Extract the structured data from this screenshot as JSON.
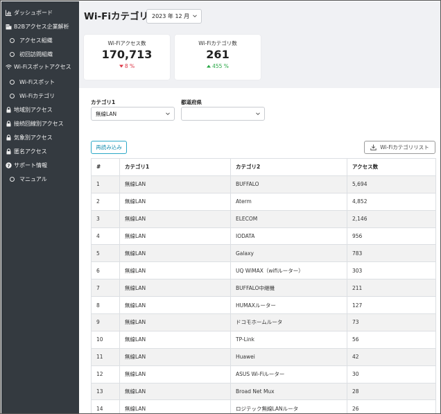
{
  "sidebar": {
    "items": [
      {
        "label": "ダッシュボード",
        "icon": "chart-bar-icon",
        "sub": false
      },
      {
        "label": "B2Bアクセス企業解析",
        "icon": "building-icon",
        "sub": false
      },
      {
        "label": "アクセス組織",
        "icon": "circle-icon",
        "sub": true
      },
      {
        "label": "初回訪問組織",
        "icon": "circle-icon",
        "sub": true
      },
      {
        "label": "Wi-Fiスポットアクセス",
        "icon": "wifi-icon",
        "sub": false
      },
      {
        "label": "Wi-Fiスポット",
        "icon": "circle-icon",
        "sub": true
      },
      {
        "label": "Wi-Fiカテゴリ",
        "icon": "circle-icon",
        "sub": true
      },
      {
        "label": "地域別アクセス",
        "icon": "lock-icon",
        "sub": false
      },
      {
        "label": "接続回線別アクセス",
        "icon": "lock-icon",
        "sub": false
      },
      {
        "label": "気象別アクセス",
        "icon": "lock-icon",
        "sub": false
      },
      {
        "label": "匿名アクセス",
        "icon": "lock-icon",
        "sub": false
      },
      {
        "label": "サポート情報",
        "icon": "question-circle-icon",
        "sub": false
      },
      {
        "label": "マニュアル",
        "icon": "circle-icon",
        "sub": true
      }
    ]
  },
  "header": {
    "title": "Wi-Fiカテゴリ",
    "month": "2023 年 12 月"
  },
  "cards": [
    {
      "label": "Wi-Fiアクセス数",
      "value": "170,713",
      "change": "8 %",
      "direction": "down",
      "color": "#dc3545"
    },
    {
      "label": "Wi-Fiカテゴリ数",
      "value": "261",
      "change": "455 %",
      "direction": "up",
      "color": "#28a745"
    }
  ],
  "filters": {
    "category1_label": "カテゴリ1",
    "category1_value": "無線LAN",
    "prefecture_label": "都道府県",
    "prefecture_value": ""
  },
  "buttons": {
    "reload": "再読み込み",
    "download_list": "Wi-Fiカテゴリリスト"
  },
  "table": {
    "headers": [
      "#",
      "カテゴリ1",
      "カテゴリ2",
      "アクセス数"
    ],
    "rows": [
      [
        "1",
        "無線LAN",
        "BUFFALO",
        "5,694"
      ],
      [
        "2",
        "無線LAN",
        "Aterm",
        "4,852"
      ],
      [
        "3",
        "無線LAN",
        "ELECOM",
        "2,146"
      ],
      [
        "4",
        "無線LAN",
        "IODATA",
        "956"
      ],
      [
        "5",
        "無線LAN",
        "Galaxy",
        "783"
      ],
      [
        "6",
        "無線LAN",
        "UQ WiMAX（wifiルーター）",
        "303"
      ],
      [
        "7",
        "無線LAN",
        "BUFFALO中継機",
        "211"
      ],
      [
        "8",
        "無線LAN",
        "HUMAXルーター",
        "127"
      ],
      [
        "9",
        "無線LAN",
        "ドコモホームルータ",
        "73"
      ],
      [
        "10",
        "無線LAN",
        "TP-Link",
        "56"
      ],
      [
        "11",
        "無線LAN",
        "Huawei",
        "42"
      ],
      [
        "12",
        "無線LAN",
        "ASUS Wi-Fiルーター",
        "30"
      ],
      [
        "13",
        "無線LAN",
        "Broad Net Mux",
        "28"
      ],
      [
        "14",
        "無線LAN",
        "ロジテック無線LANルータ",
        "26"
      ]
    ]
  },
  "colors": {
    "sidebar_bg": "#343a40",
    "accent": "#2aa7c7",
    "down": "#dc3545",
    "up": "#28a745"
  }
}
